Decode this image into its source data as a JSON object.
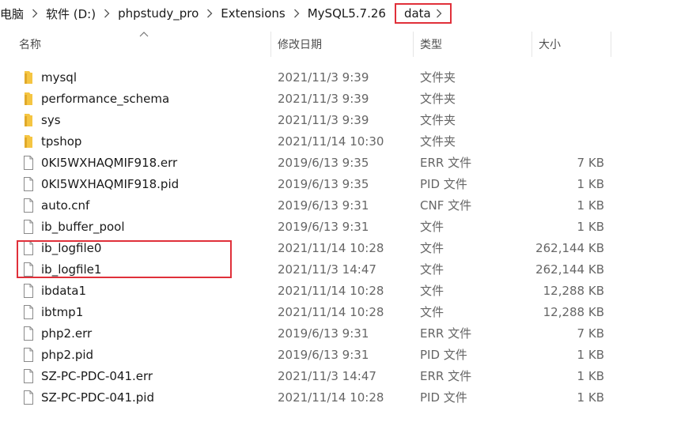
{
  "breadcrumb": {
    "items": [
      "电脑",
      "软件 (D:)",
      "phpstudy_pro",
      "Extensions",
      "MySQL5.7.26"
    ],
    "current": "data"
  },
  "columns": {
    "name": "名称",
    "date": "修改日期",
    "type": "类型",
    "size": "大小"
  },
  "colors": {
    "folder": "#f5c542",
    "highlight": "#e0303a"
  },
  "files": [
    {
      "name": "mysql",
      "date": "2021/11/3 9:39",
      "type": "文件夹",
      "size": "",
      "icon": "folder-icon"
    },
    {
      "name": "performance_schema",
      "date": "2021/11/3 9:39",
      "type": "文件夹",
      "size": "",
      "icon": "folder-icon"
    },
    {
      "name": "sys",
      "date": "2021/11/3 9:39",
      "type": "文件夹",
      "size": "",
      "icon": "folder-icon"
    },
    {
      "name": "tpshop",
      "date": "2021/11/14 10:30",
      "type": "文件夹",
      "size": "",
      "icon": "folder-icon"
    },
    {
      "name": "0KI5WXHAQMIF918.err",
      "date": "2019/6/13 9:35",
      "type": "ERR 文件",
      "size": "7 KB",
      "icon": "file-icon"
    },
    {
      "name": "0KI5WXHAQMIF918.pid",
      "date": "2019/6/13 9:35",
      "type": "PID 文件",
      "size": "1 KB",
      "icon": "file-icon"
    },
    {
      "name": "auto.cnf",
      "date": "2019/6/13 9:31",
      "type": "CNF 文件",
      "size": "1 KB",
      "icon": "file-icon"
    },
    {
      "name": "ib_buffer_pool",
      "date": "2019/6/13 9:31",
      "type": "文件",
      "size": "1 KB",
      "icon": "file-icon"
    },
    {
      "name": "ib_logfile0",
      "date": "2021/11/14 10:28",
      "type": "文件",
      "size": "262,144 KB",
      "icon": "file-icon"
    },
    {
      "name": "ib_logfile1",
      "date": "2021/11/3 14:47",
      "type": "文件",
      "size": "262,144 KB",
      "icon": "file-icon"
    },
    {
      "name": "ibdata1",
      "date": "2021/11/14 10:28",
      "type": "文件",
      "size": "12,288 KB",
      "icon": "file-icon"
    },
    {
      "name": "ibtmp1",
      "date": "2021/11/14 10:28",
      "type": "文件",
      "size": "12,288 KB",
      "icon": "file-icon"
    },
    {
      "name": "php2.err",
      "date": "2019/6/13 9:31",
      "type": "ERR 文件",
      "size": "7 KB",
      "icon": "file-icon"
    },
    {
      "name": "php2.pid",
      "date": "2019/6/13 9:31",
      "type": "PID 文件",
      "size": "1 KB",
      "icon": "file-icon"
    },
    {
      "name": "SZ-PC-PDC-041.err",
      "date": "2021/11/3 14:47",
      "type": "ERR 文件",
      "size": "1 KB",
      "icon": "file-icon"
    },
    {
      "name": "SZ-PC-PDC-041.pid",
      "date": "2021/11/14 10:28",
      "type": "PID 文件",
      "size": "1 KB",
      "icon": "file-icon"
    }
  ]
}
